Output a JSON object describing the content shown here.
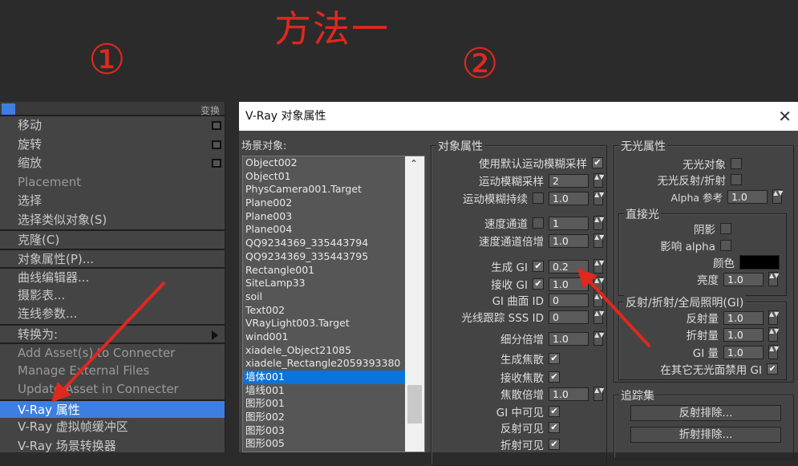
{
  "annotations": {
    "title": "方法一",
    "step1": "①",
    "step2": "②",
    "color": "#e0281e"
  },
  "menu": {
    "header": "变换",
    "items": [
      {
        "label": "移动"
      },
      {
        "label": "旋转"
      },
      {
        "label": "缩放"
      },
      {
        "label": "Placement"
      },
      {
        "label": "选择"
      },
      {
        "label": "选择类似对象(S)"
      },
      {
        "label": "克隆(C)"
      },
      {
        "label": "对象属性(P)..."
      },
      {
        "label": "曲线编辑器..."
      },
      {
        "label": "摄影表..."
      },
      {
        "label": "连线参数..."
      },
      {
        "label": "转换为:"
      },
      {
        "label": "Add Asset(s) to Connecter"
      },
      {
        "label": "Manage External Files"
      },
      {
        "label": "Update Asset in Connecter"
      },
      {
        "label": "V-Ray 属性"
      },
      {
        "label": "V-Ray 虚拟帧缓冲区"
      },
      {
        "label": "V-Ray 场景转换器"
      }
    ],
    "selected": "V-Ray 属性"
  },
  "dialog": {
    "title": "V-Ray 对象属性",
    "scene_label": "场景对象:",
    "scene_objects": [
      "Object002",
      "Object01",
      "PhysCamera001.Target",
      "Plane002",
      "Plane003",
      "Plane004",
      "QQ9234369_335443794",
      "QQ9234369_335443795",
      "Rectangle001",
      "SiteLamp33",
      "soil",
      "Text002",
      "VRayLight003.Target",
      "wind001",
      "xiadele_Object21085",
      "xiadele_Rectangle2059393380",
      "墙体001",
      "墙线001",
      "图形001",
      "图形002",
      "图形003",
      "图形005"
    ],
    "selected_object": "墙体001",
    "object_props": {
      "title": "对象属性",
      "rows": [
        {
          "label": "使用默认运动模糊采样",
          "check": true
        },
        {
          "label": "运动模糊采样",
          "value": "2"
        },
        {
          "label": "运动模糊持续",
          "check": false,
          "value": "1.0"
        },
        {
          "label": "速度通道",
          "check": false,
          "value": "1"
        },
        {
          "label": "速度通道倍增",
          "value": "1.0"
        },
        {
          "label": "生成 GI",
          "check": true,
          "value": "0.2"
        },
        {
          "label": "接收 GI",
          "check": true,
          "value": "1.0"
        },
        {
          "label": "GI 曲面 ID",
          "value": "0"
        },
        {
          "label": "光线跟踪 SSS ID",
          "value": "0"
        },
        {
          "label": "细分倍增",
          "value": "1.0"
        },
        {
          "label": "生成焦散",
          "check": true
        },
        {
          "label": "接收焦散",
          "check": true
        },
        {
          "label": "焦散倍增",
          "value": "1.0"
        },
        {
          "label": "GI 中可见",
          "check": true
        },
        {
          "label": "反射可见",
          "check": true
        },
        {
          "label": "折射可见",
          "check": true
        }
      ]
    },
    "matte": {
      "title": "无光属性",
      "matte_object": "无光对象",
      "matte_object_checked": false,
      "matte_refl": "无光反射/折射",
      "matte_refl_checked": false,
      "alpha_label": "Alpha 参考",
      "alpha_value": "1.0",
      "direct": {
        "title": "直接光",
        "shadow": "阴影",
        "shadow_checked": false,
        "affect_alpha": "影响 alpha",
        "affect_alpha_checked": false,
        "color": "颜色",
        "color_value": "#000000",
        "brightness": "亮度",
        "brightness_value": "1.0"
      },
      "gi": {
        "title": "反射/折射/全局照明(GI)",
        "refl": "反射量",
        "refl_value": "1.0",
        "refr": "折射量",
        "refr_value": "1.0",
        "gi": "GI 量",
        "gi_value": "1.0",
        "disable": "在其它无光面禁用 GI",
        "disable_checked": true
      }
    },
    "trace": {
      "title": "追踪集",
      "refl_btn": "反射排除...",
      "refr_btn": "折射排除..."
    }
  }
}
